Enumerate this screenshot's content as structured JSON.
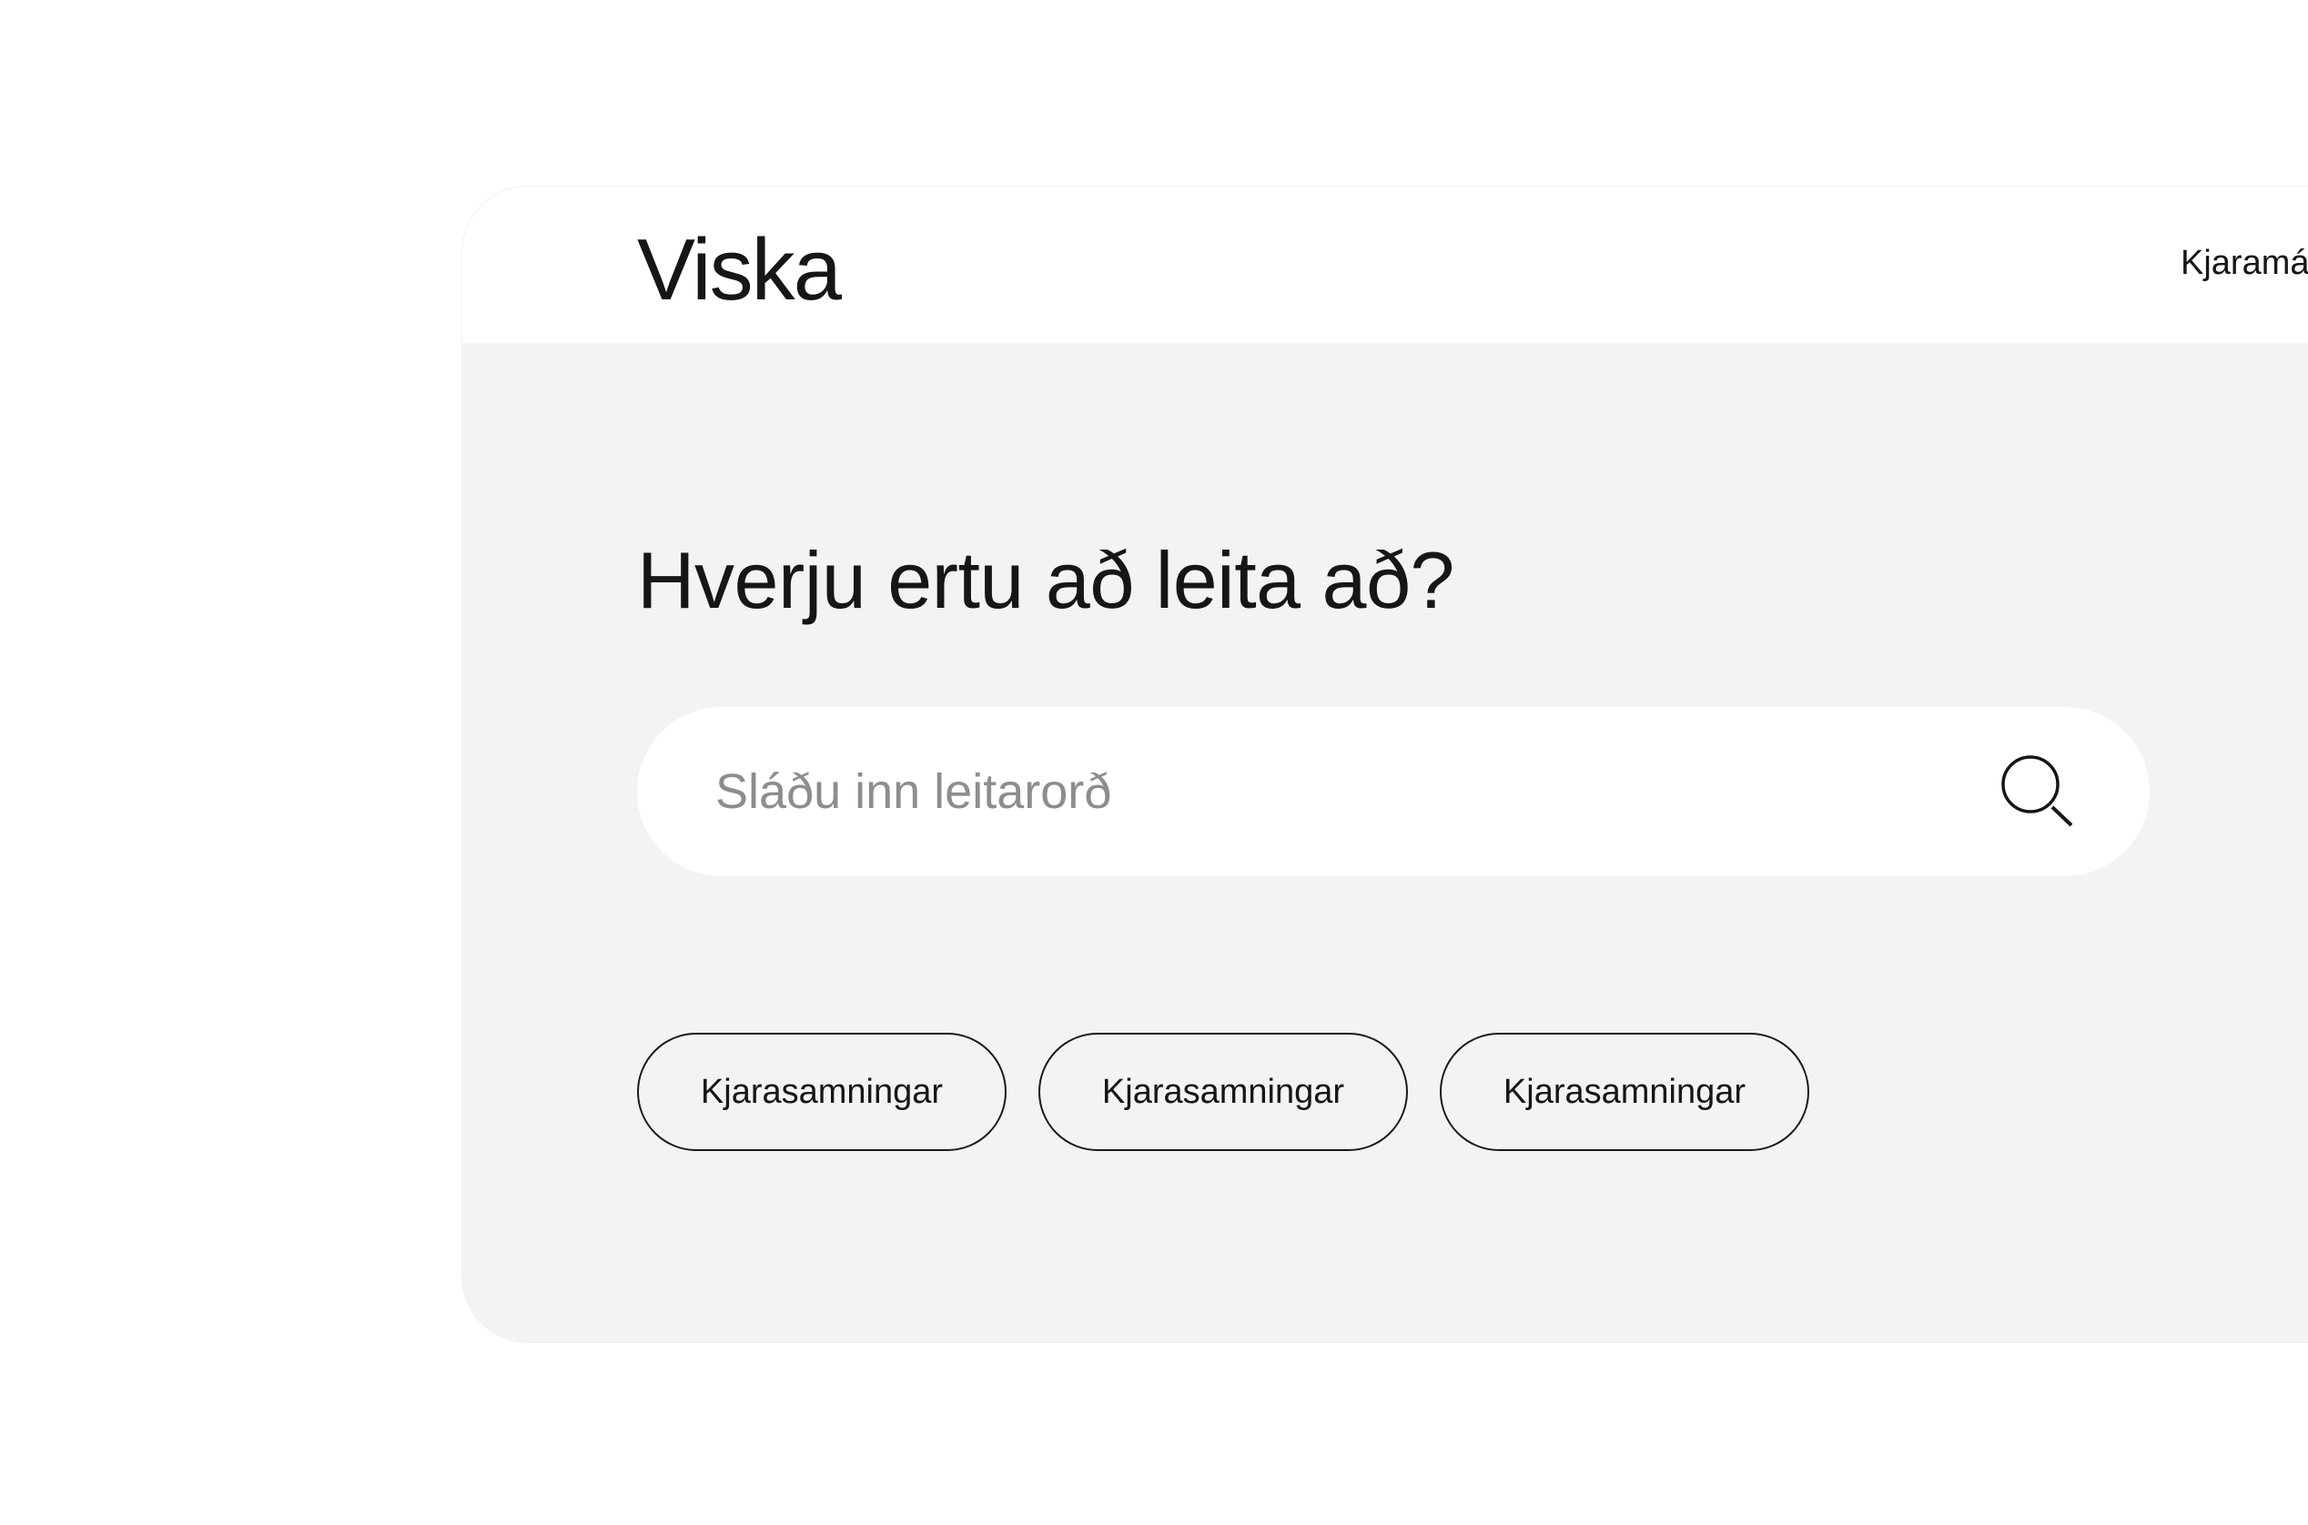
{
  "header": {
    "logo": "Viska",
    "nav_link": "Kjaramá"
  },
  "main": {
    "heading": "Hverju ertu að leita að?",
    "search": {
      "placeholder": "Sláðu inn leitarorð",
      "icon": "search-icon"
    },
    "chips": [
      {
        "label": "Kjarasamningar"
      },
      {
        "label": "Kjarasamningar"
      },
      {
        "label": "Kjarasamningar"
      }
    ]
  },
  "colors": {
    "page_background": "#ffffff",
    "card_background": "#f3f3f3",
    "header_background": "#ffffff",
    "text": "#161616",
    "placeholder": "#8d8d8d",
    "chip_border": "#1a1a1a"
  }
}
